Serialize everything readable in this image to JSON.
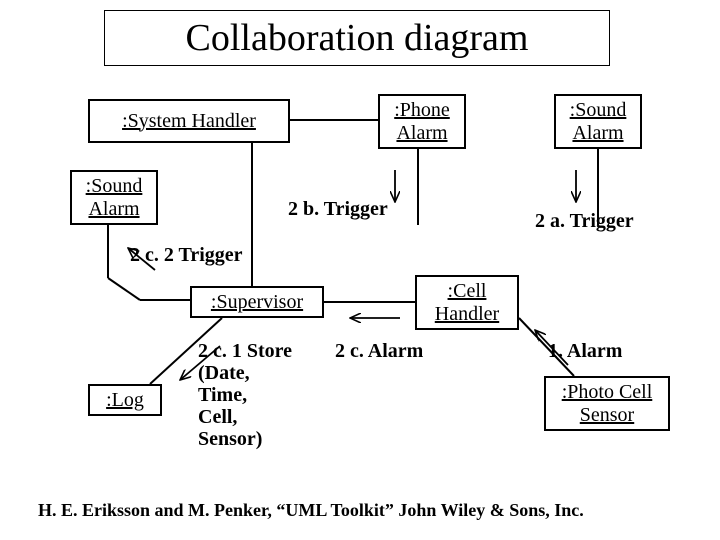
{
  "title": "Collaboration diagram",
  "objects": {
    "system_handler": ":System Handler",
    "phone_alarm": ":Phone Alarm",
    "sound_alarm_right": ":Sound Alarm",
    "sound_alarm_left": ":Sound Alarm",
    "supervisor": ":Supervisor",
    "cell_handler": ":Cell Handler",
    "log": ":Log",
    "photo_cell_sensor": ":Photo Cell Sensor"
  },
  "messages": {
    "m_2b": "2 b. Trigger",
    "m_2a": "2 a. Trigger",
    "m_2c2": "2 c. 2 Trigger",
    "m_2c1_l1": "2 c. 1 Store",
    "m_2c1_l2": "(Date,",
    "m_2c1_l3": "Time,",
    "m_2c1_l4": "Cell,",
    "m_2c1_l5": "Sensor)",
    "m_2c": "2 c. Alarm",
    "m_1": "1. Alarm"
  },
  "citation": "H. E. Eriksson and M. Penker, “UML Toolkit” John Wiley & Sons, Inc."
}
